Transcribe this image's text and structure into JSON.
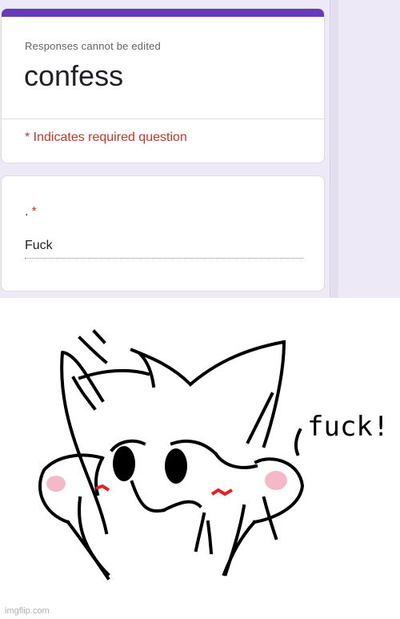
{
  "form": {
    "subtitle": "Responses cannot be edited",
    "title": "confess",
    "required_note": "* Indicates required question",
    "question": {
      "label": ".",
      "required_mark": "*",
      "answer": "Fuck"
    },
    "accent_color": "#673ab7",
    "required_color": "#d93025"
  },
  "drawing": {
    "caption": "fuck!"
  },
  "watermark": "imgflip.com"
}
